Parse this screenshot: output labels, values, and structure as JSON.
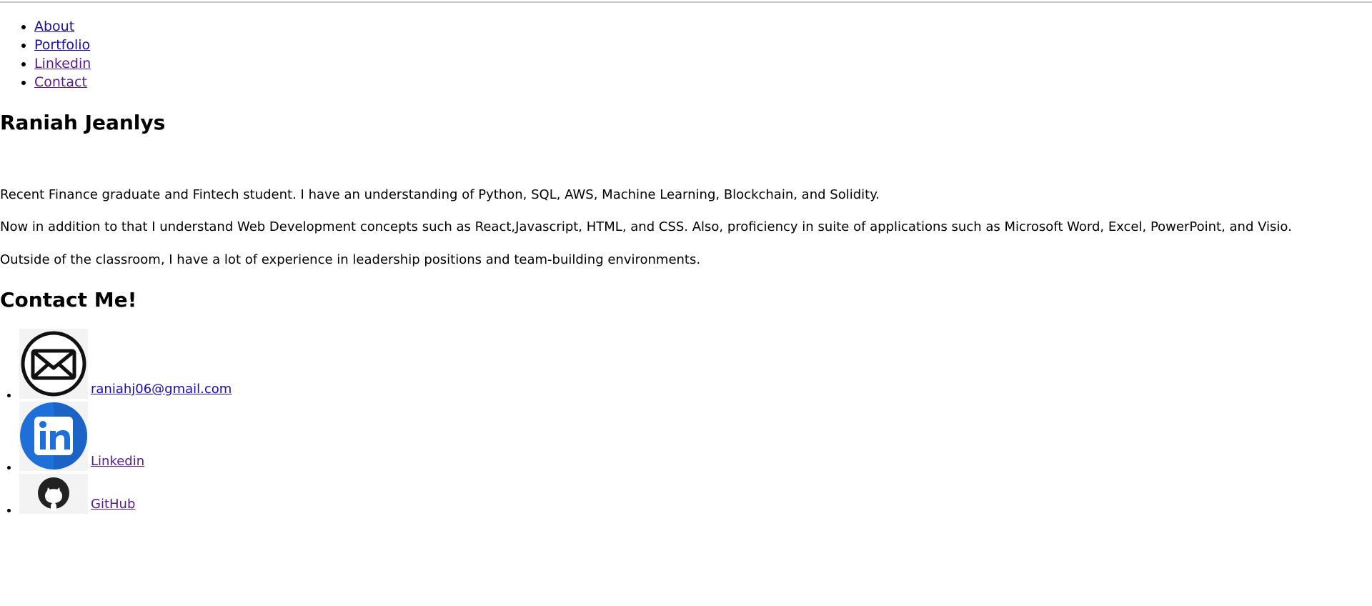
{
  "nav": {
    "items": [
      {
        "label": "About",
        "state": "unvisited"
      },
      {
        "label": "Portfolio",
        "state": "unvisited"
      },
      {
        "label": "Linkedin",
        "state": "visited"
      },
      {
        "label": "Contact",
        "state": "visited"
      }
    ]
  },
  "main": {
    "title": "Raniah Jeanlys",
    "bio": [
      "Recent Finance graduate and Fintech student. I have an understanding of Python, SQL, AWS, Machine Learning, Blockchain, and Solidity.",
      "Now in addition to that I understand Web Development concepts such as React,Javascript, HTML, and CSS. Also, proficiency in suite of applications such as Microsoft Word, Excel, PowerPoint, and Visio.",
      "Outside of the classroom, I have a lot of experience in leadership positions and team-building environments."
    ]
  },
  "contact": {
    "heading": "Contact Me!",
    "items": [
      {
        "label": " raniahj06@gmail.com",
        "icon": "envelope-icon"
      },
      {
        "label": " Linkedin",
        "icon": "linkedin-icon"
      },
      {
        "label": " GitHub",
        "icon": "github-icon"
      }
    ]
  },
  "colors": {
    "link_unvisited": "#1a0dab",
    "link_visited": "#551a8b",
    "linkedin_blue": "#1e6fd9"
  }
}
